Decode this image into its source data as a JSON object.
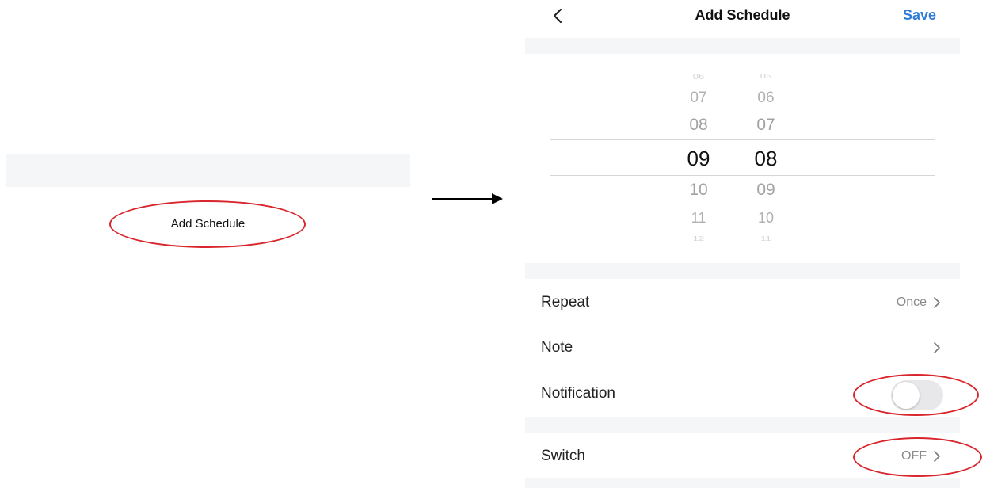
{
  "left_panel": {
    "add_schedule_label": "Add Schedule"
  },
  "header": {
    "title": "Add Schedule",
    "save_label": "Save",
    "back_icon": "chevron-left-icon"
  },
  "time_picker": {
    "hour_options": [
      "06",
      "07",
      "08",
      "09",
      "10",
      "11",
      "12"
    ],
    "minute_options": [
      "05",
      "06",
      "07",
      "08",
      "09",
      "10",
      "11"
    ],
    "selected_hour": "09",
    "selected_minute": "08"
  },
  "settings": {
    "repeat": {
      "label": "Repeat",
      "value": "Once"
    },
    "note": {
      "label": "Note",
      "value": ""
    },
    "notification": {
      "label": "Notification",
      "enabled": false
    },
    "switch": {
      "label": "Switch",
      "value": "OFF"
    }
  },
  "colors": {
    "accent": "#2f7bd9",
    "highlight_oval": "#d9262c",
    "section_gray": "#f5f6f8",
    "toggle_off": "#e8e8ea"
  }
}
